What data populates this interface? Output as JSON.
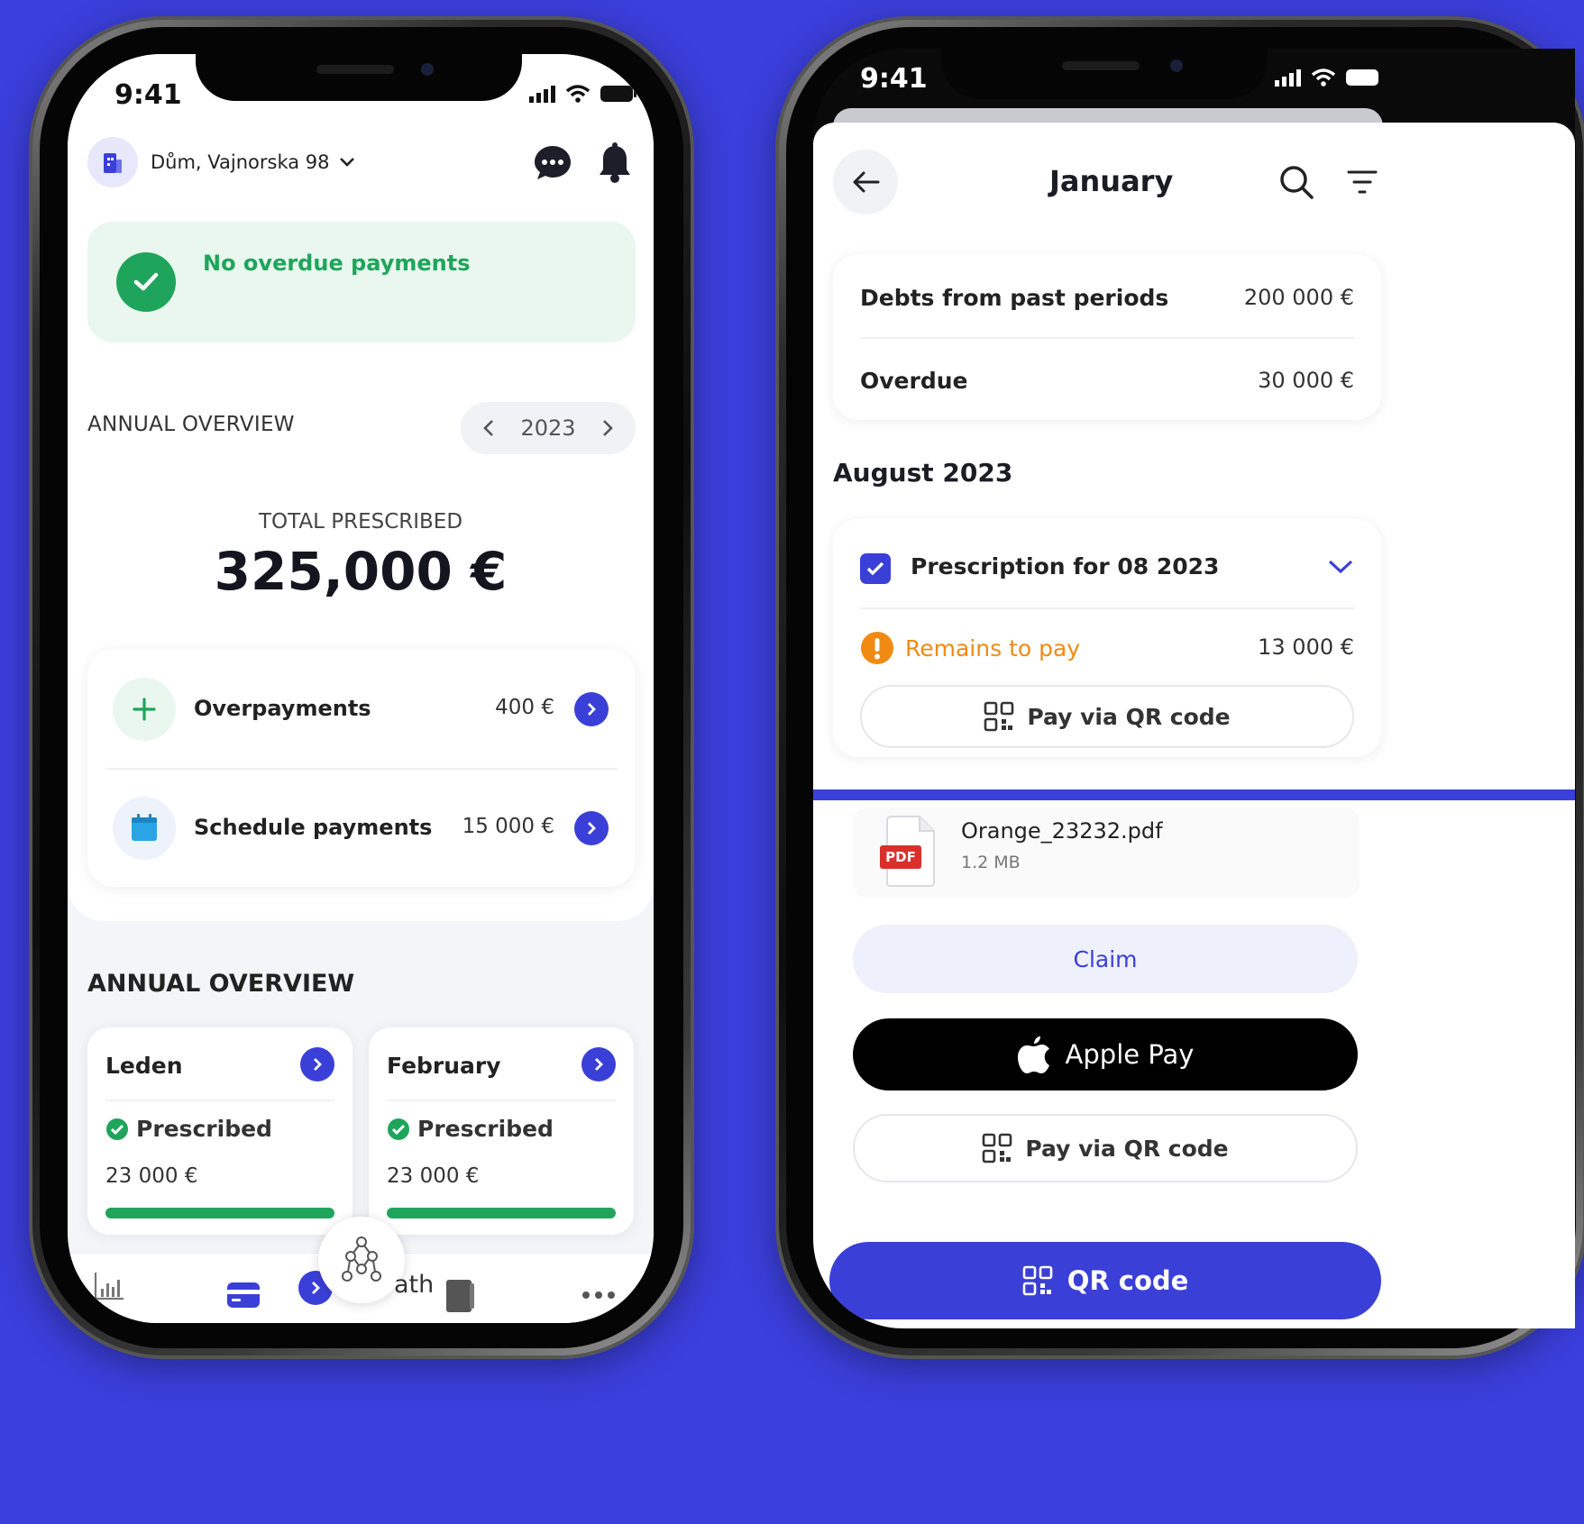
{
  "status_bar": {
    "time_left": "9:41",
    "time_right": "9:41"
  },
  "left": {
    "header": {
      "address": "Dům, Vajnorska 98"
    },
    "banner": {
      "text": "No overdue payments"
    },
    "annual_overview": {
      "title": "ANNUAL OVERVIEW",
      "year": "2023",
      "total_label": "TOTAL PRESCRIBED",
      "total_value": "325,000 €"
    },
    "summary_rows": [
      {
        "label": "Overpayments",
        "value": "400 €"
      },
      {
        "label": "Schedule payments",
        "value": "15 000 €"
      }
    ],
    "monthly": {
      "title": "ANNUAL OVERVIEW",
      "cards": [
        {
          "month": "Leden",
          "status": "Prescribed",
          "amount": "23 000 €"
        },
        {
          "month": "February",
          "status": "Prescribed",
          "amount": "23 000 €"
        }
      ]
    },
    "tabbar": {
      "partial_label": "ath"
    }
  },
  "right": {
    "header": {
      "title": "January"
    },
    "debts": [
      {
        "label": "Debts from past periods",
        "value": "200 000 €"
      },
      {
        "label": "Overdue",
        "value": "30 000 €"
      }
    ],
    "section_title": "August 2023",
    "prescription": {
      "title": "Prescription for 08 2023",
      "remains_label": "Remains to pay",
      "remains_value": "13 000 €",
      "pay_qr_label": "Pay via QR code"
    },
    "attachment": {
      "badge": "PDF",
      "filename": "Orange_23232.pdf",
      "size": "1.2 MB"
    },
    "claim_label": "Claim",
    "apple_pay_label": "Apple Pay",
    "pay_qr_label_2": "Pay via QR code",
    "qr_code_label": "QR code"
  },
  "colors": {
    "background": "#3b3fdc",
    "accent": "#3a3fd8",
    "success": "#1fa55b",
    "success_bg": "#e9f7ee",
    "warning": "#f08a12",
    "pdf_red": "#d9302c"
  }
}
